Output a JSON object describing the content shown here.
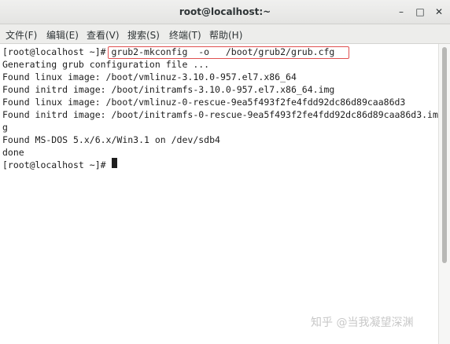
{
  "window": {
    "title": "root@localhost:~",
    "minimize_glyph": "–",
    "maximize_glyph": "□",
    "close_glyph": "✕"
  },
  "menu": {
    "items": [
      {
        "label": "文件(F)"
      },
      {
        "label": "编辑(E)"
      },
      {
        "label": "查看(V)"
      },
      {
        "label": "搜索(S)"
      },
      {
        "label": "终端(T)"
      },
      {
        "label": "帮助(H)"
      }
    ]
  },
  "terminal": {
    "lines": [
      "[root@localhost ~]# grub2-mkconfig  -o   /boot/grub2/grub.cfg",
      "Generating grub configuration file ...",
      "Found linux image: /boot/vmlinuz-3.10.0-957.el7.x86_64",
      "Found initrd image: /boot/initramfs-3.10.0-957.el7.x86_64.img",
      "Found linux image: /boot/vmlinuz-0-rescue-9ea5f493f2fe4fdd92dc86d89caa86d3",
      "Found initrd image: /boot/initramfs-0-rescue-9ea5f493f2fe4fdd92dc86d89caa86d3.im",
      "g",
      "Found MS-DOS 5.x/6.x/Win3.1 on /dev/sdb4",
      "done",
      "[root@localhost ~]# "
    ]
  },
  "watermark": "知乎 @当我凝望深渊",
  "colors": {
    "highlight_border": "#e05050",
    "text": "#1e1e1e",
    "background": "#ffffff"
  }
}
